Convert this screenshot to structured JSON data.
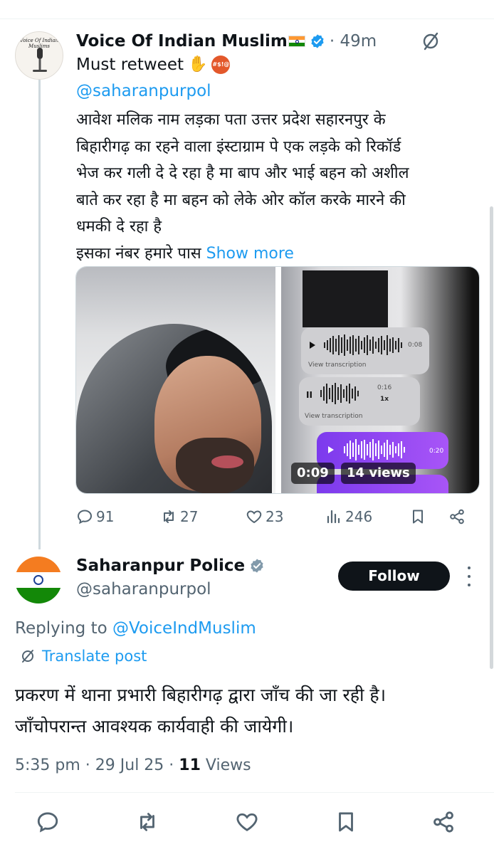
{
  "tweet1": {
    "display_name": "Voice Of Indian Muslim",
    "avatar_caption": "Voice Of Indian Muslims",
    "time": "· 49m",
    "line1": "Must retweet",
    "emoji_symbol": "#$!@",
    "mention": "@saharanpurpol",
    "body_lines": [
      "आवेश मलिक नाम लड़का पता उत्तर प्रदेश  सहारनपुर के",
      "बिहारीगढ़ का रहने वाला इंस्टाग्राम पे एक लड़के को रिकॉर्ड",
      "भेज कर गली दे दे रहा है   मा बाप और भाई बहन को अशील",
      "बाते कर रहा है मा बहन को लेके ओर कॉल करके मारने की",
      "धमकी दे रहा है"
    ],
    "last_line": "इसका नंबर हमारे पास",
    "show_more": "Show more",
    "media": {
      "video_time": "0:09",
      "video_views": "14 views",
      "chat": {
        "t1": "0:08",
        "transcription1": "View transcription",
        "t2": "0:16",
        "speed": "1x",
        "transcription2": "View transcription",
        "t3": "0:20"
      }
    },
    "actions": {
      "replies": "91",
      "reposts": "27",
      "likes": "23",
      "views": "246"
    }
  },
  "tweet2": {
    "display_name": "Saharanpur Police",
    "handle": "@saharanpurpol",
    "follow_label": "Follow",
    "replying_prefix": "Replying to",
    "replying_to": "@VoiceIndMuslim",
    "translate_label": "Translate post",
    "body_lines": [
      "प्रकरण में थाना प्रभारी बिहारीगढ़ द्वारा जाँच की जा रही है।",
      "जाँचोपरान्त आवश्यक कार्यवाही की जायेगी।"
    ],
    "time": "5:35 pm · 29 Jul 25 ·",
    "views_count": "11",
    "views_label": "Views"
  },
  "colors": {
    "accent": "#1d9bf0",
    "text": "#0f1419",
    "muted": "#536471"
  }
}
